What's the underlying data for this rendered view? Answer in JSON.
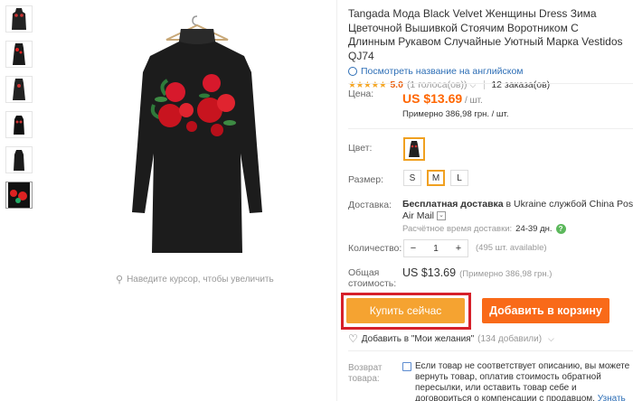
{
  "gallery": {
    "thumbnails": 6,
    "zoom_hint": "Наведите курсор, чтобы увеличить"
  },
  "product": {
    "title": "Tangada Мода Black Velvet Женщины Dress Зима Цветочной Вышивкой Стоячим Воротником С Длинным Рукавом Случайные Уютный Марка Vestidos QJ74",
    "translate_link": "Посмотреть название на английском",
    "stars": "★★★★★",
    "rating": "5.0",
    "votes": "(1 голоса(ов))",
    "orders": "12 заказа(ов)"
  },
  "pricing": {
    "label": "Цена:",
    "price": "US $13.69",
    "unit": " / шт.",
    "approx": "Примерно 386,98 грн. / шт."
  },
  "options": {
    "color_label": "Цвет:",
    "size_label": "Размер:",
    "sizes": [
      "S",
      "M",
      "L"
    ],
    "selected_size": "M"
  },
  "shipping": {
    "label": "Доставка:",
    "free": "Бесплатная доставка",
    "dest": " в Ukraine службой China Post Registered",
    "method": "Air Mail",
    "eta_label": "Расчётное время доставки:",
    "eta_days": "24-39 дн."
  },
  "quantity": {
    "label": "Количество:",
    "minus": "−",
    "value": "1",
    "plus": "+",
    "available": "(495 шт. available)"
  },
  "total": {
    "label_1": "Общая",
    "label_2": "стоимость:",
    "value": "US $13.69",
    "approx": "(Примерно 386,98 грн.)"
  },
  "actions": {
    "buy_now": "Купить сейчас",
    "add_to_cart": "Добавить в корзину",
    "wishlist": "Добавить в \"Мои желания\"",
    "wishlist_count": "(134 добавили)"
  },
  "returns": {
    "label_1": "Возврат",
    "label_2": "товара:",
    "text": "Если товар не соответствует описанию, вы можете вернуть товар, оплатив стоимость обратной пересылки, или оставить товар себе и договориться о компенсации с продавцом.",
    "more": "Узнать подробнее ▸"
  },
  "colors": {
    "price": "#ff6600",
    "buy_button": "#f5a331",
    "cart_button": "#f96a19",
    "highlight": "#d6202a",
    "selected_border": "#f0a020",
    "link": "#2e6fb6"
  }
}
